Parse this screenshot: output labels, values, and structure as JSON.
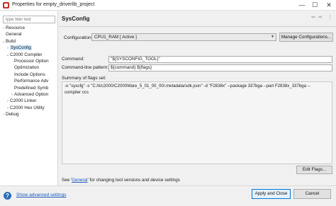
{
  "window": {
    "title": "Properties for empty_driverlib_project",
    "minimize": "—",
    "maximize": "☐",
    "close": "✕"
  },
  "filter": {
    "placeholder": "type filter text"
  },
  "tree": [
    {
      "label": "Resource",
      "indent": 0,
      "twisty": "›",
      "selected": false
    },
    {
      "label": "General",
      "indent": 0,
      "twisty": "",
      "selected": false
    },
    {
      "label": "Build",
      "indent": 0,
      "twisty": "⌄",
      "selected": false
    },
    {
      "label": "SysConfig",
      "indent": 1,
      "twisty": "›",
      "selected": true
    },
    {
      "label": "C2000 Compiler",
      "indent": 1,
      "twisty": "⌄",
      "selected": false
    },
    {
      "label": "Processor Option",
      "indent": 2,
      "twisty": "",
      "selected": false
    },
    {
      "label": "Optimization",
      "indent": 2,
      "twisty": "",
      "selected": false
    },
    {
      "label": "Include Options",
      "indent": 2,
      "twisty": "",
      "selected": false
    },
    {
      "label": "Performance Adv",
      "indent": 2,
      "twisty": "",
      "selected": false
    },
    {
      "label": "Predefined Symb",
      "indent": 2,
      "twisty": "",
      "selected": false
    },
    {
      "label": "Advanced Option",
      "indent": 2,
      "twisty": "›",
      "selected": false
    },
    {
      "label": "C2000 Linker",
      "indent": 1,
      "twisty": "›",
      "selected": false
    },
    {
      "label": "C2000 Hex Utility",
      "indent": 1,
      "twisty": "›",
      "selected": false
    },
    {
      "label": "Debug",
      "indent": 0,
      "twisty": "›",
      "selected": false
    }
  ],
  "page": {
    "heading": "SysConfig",
    "nav_back": "⇦",
    "nav_forward": "⇨",
    "menu": "⋮"
  },
  "configuration": {
    "label": "Configuration:",
    "value": "CPU1_RAM  [ Active ]",
    "manage_label": "Manage Configurations..."
  },
  "command": {
    "label": "Command:",
    "value": "\"${SYSCONFIG_TOOL}\""
  },
  "pattern": {
    "label": "Command-line pattern:",
    "value": "${command} ${flags}"
  },
  "summary": {
    "label": "Summary of flags set:",
    "lines": [
      "-o \"syscfg\" -s \"C:/ti/c2000/C2000Ware_5_01_00_00/.metadata/sdk.json\" -d \"F2838x\" --package 337bga --part F2838x_337bga --",
      "compiler ccs"
    ]
  },
  "edit_flags_label": "Edit Flags...",
  "note": {
    "prefix": "See '",
    "link": "General",
    "suffix": "' for changing tool versions and device settings"
  },
  "footer": {
    "help_icon": "?",
    "show_advanced": "Show advanced settings",
    "apply_close": "Apply and Close",
    "cancel": "Cancel"
  }
}
